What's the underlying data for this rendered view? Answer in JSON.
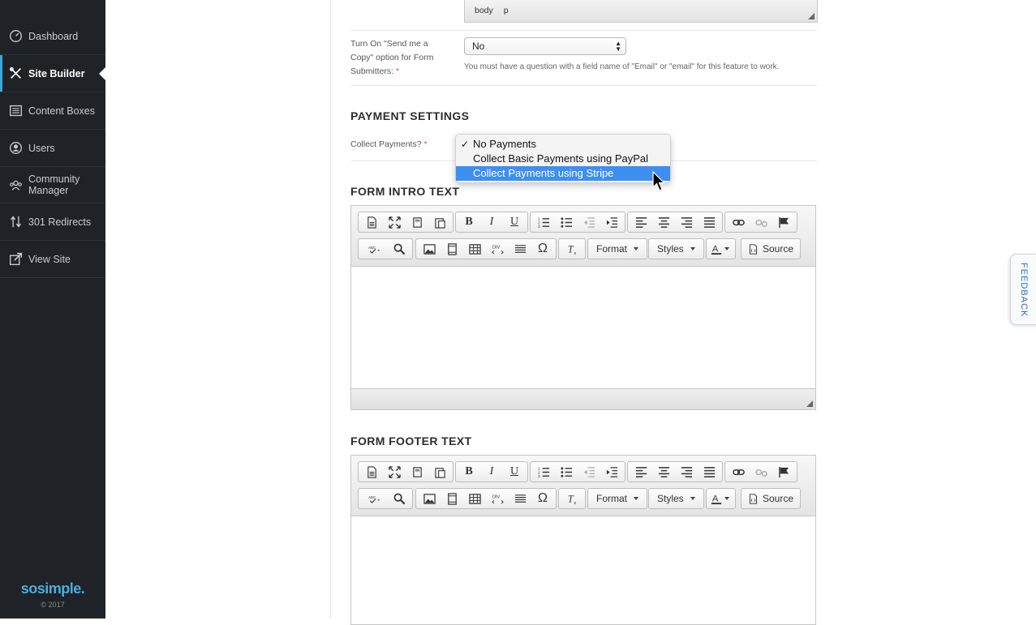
{
  "sidebar": {
    "items": [
      {
        "label": "Dashboard",
        "icon": "dashboard-icon"
      },
      {
        "label": "Site Builder",
        "icon": "tools-icon"
      },
      {
        "label": "Content Boxes",
        "icon": "content-boxes-icon"
      },
      {
        "label": "Users",
        "icon": "user-icon"
      },
      {
        "label": "Community Manager",
        "icon": "community-icon"
      },
      {
        "label": "301 Redirects",
        "icon": "redirect-icon"
      },
      {
        "label": "View Site",
        "icon": "external-link-icon"
      }
    ],
    "active_index": 1,
    "logo": "sosimple.",
    "copyright": "© 2017",
    "accent_color": "#3aa6d8"
  },
  "path_bar": {
    "items": [
      "body",
      "p"
    ]
  },
  "send_copy": {
    "label": "Turn On \"Send me a Copy\" option for Form Submitters:",
    "required_mark": "*",
    "value": "No",
    "help": "You must have a question with a field name of \"Email\" or \"email\" for this feature to work."
  },
  "payment": {
    "section_title": "PAYMENT SETTINGS",
    "label": "Collect Payments?",
    "required_mark": "*",
    "options": [
      "No Payments",
      "Collect Basic Payments using PayPal",
      "Collect Payments using Stripe"
    ],
    "checkmark": "✓",
    "highlight_color": "#3d8ff0"
  },
  "intro": {
    "section_title": "FORM INTRO TEXT"
  },
  "footer": {
    "section_title": "FORM FOOTER TEXT"
  },
  "toolbar": {
    "format_label": "Format",
    "styles_label": "Styles",
    "source_label": "Source",
    "omega": "Ω",
    "bold": "B",
    "italic": "I",
    "underline": "U"
  },
  "feedback": {
    "label": "FEEDBACK"
  }
}
